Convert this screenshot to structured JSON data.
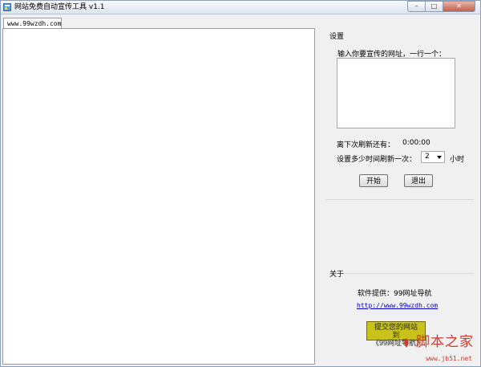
{
  "window": {
    "title": "网站免费自动宣传工具 v1.1",
    "controls": {
      "minimize": "–",
      "maximize": "□",
      "close": "✕"
    }
  },
  "browser": {
    "tab_label": "www.99wzdh.com"
  },
  "settings": {
    "section_title": "设置",
    "input_label": "输入你要宣传的网址，一行一个：",
    "input_value": "",
    "countdown_label": "离下次刷新还有：",
    "countdown_value": "0:00:00",
    "interval_label": "设置多少时间刷新一次：",
    "interval_value": "2",
    "interval_unit": "小时",
    "start_button": "开始",
    "exit_button": "退出"
  },
  "about": {
    "section_title": "关于",
    "provider_text": "软件提供：99网址导航",
    "link_text": "http://www.99wzdh.com",
    "submit_button_line1": "提交您的网站到",
    "submit_button_line2": "《99网址导航》"
  },
  "watermark": {
    "main": "脚本之家",
    "sub": "www.jb51.net"
  },
  "icons": {
    "app": "app-icon",
    "dropdown": "chevron-down-icon"
  },
  "colors": {
    "submit_button_bg": "#c9c219",
    "watermark": "#d13a2a",
    "link": "#0000cc"
  }
}
